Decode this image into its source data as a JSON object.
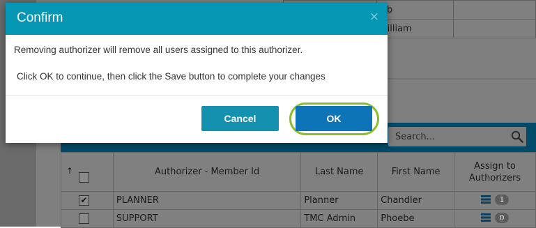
{
  "dialog": {
    "title": "Confirm",
    "close_glyph": "×",
    "message_line1": "Removing authorizer will remove all users assigned to this authorizer.",
    "message_line2": "Click OK to continue, then click the Save button to complete your changes",
    "cancel_label": "Cancel",
    "ok_label": "OK",
    "header_color": "#0596b4",
    "ok_color": "#0d74b7",
    "highlight_color": "#8cbd2c"
  },
  "background": {
    "top_rows": [
      {
        "first_name_fragment": "ob"
      },
      {
        "first_name_fragment": "Villiam"
      }
    ],
    "search": {
      "placeholder": "Search..."
    },
    "table": {
      "sort_glyph": "↑",
      "headers": {
        "authorizer": "Authorizer - Member Id",
        "last_name": "Last Name",
        "first_name": "First Name",
        "assign": "Assign to Authorizers"
      },
      "rows": [
        {
          "checked": "✔",
          "authorizer": "PLANNER",
          "last_name": "Planner",
          "first_name": "Chandler",
          "count": "1"
        },
        {
          "checked": "",
          "authorizer": "SUPPORT",
          "last_name": "TMC Admin",
          "first_name": "Phoebe",
          "count": "0"
        }
      ]
    }
  }
}
